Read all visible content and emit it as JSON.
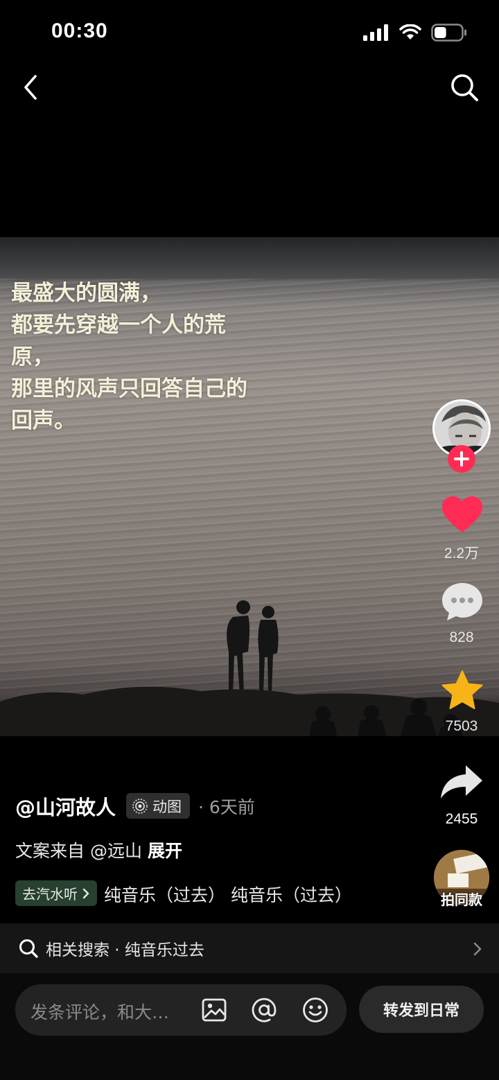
{
  "status_bar": {
    "time": "00:30",
    "battery_level": 0.45
  },
  "post": {
    "caption_lines": [
      "最盛大的圆满，",
      "都要先穿越一个人的荒",
      "原，",
      "那里的风声只回答自己的",
      "回声。"
    ],
    "author": "@山河故人",
    "badge": "动图",
    "time": "· 6天前",
    "description": "文案来自 @远山",
    "expand_label": "展开",
    "music_button": "去汽水听",
    "music_text": "纯音乐（过去）    纯音乐（过去）"
  },
  "actions": {
    "likes": "2.2万",
    "comments": "828",
    "favorites": "7503",
    "shares": "2455",
    "same_style": "拍同款"
  },
  "related_search": {
    "label": "相关搜索 · 纯音乐过去"
  },
  "bottom_bar": {
    "comment_placeholder": "发条评论，和大…",
    "share_daily": "转发到日常"
  },
  "colors": {
    "like": "#fe2c55",
    "favorite": "#f6b417",
    "follow": "#fe2c55",
    "caption": "#f4f0d8"
  }
}
